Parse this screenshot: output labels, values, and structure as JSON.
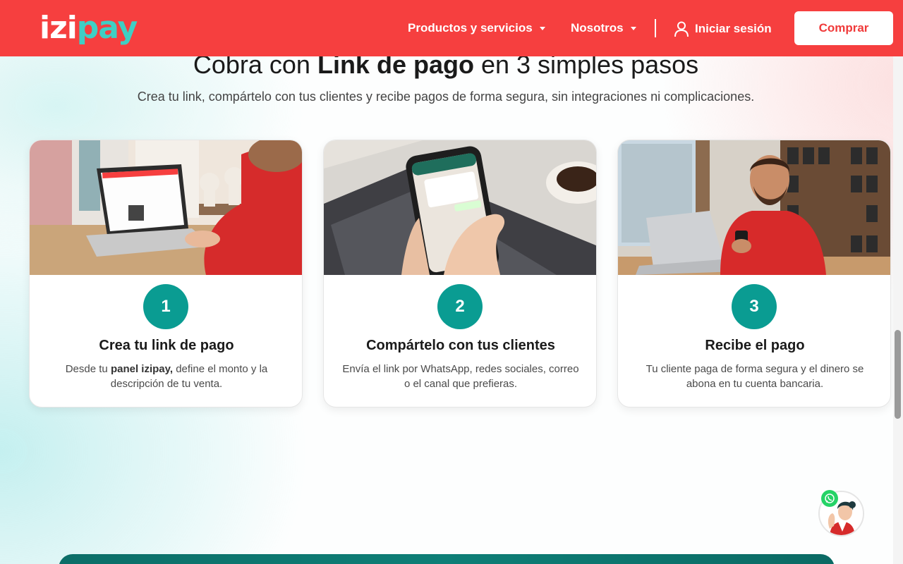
{
  "header": {
    "logo": {
      "part1": "izi",
      "part2": "pay"
    },
    "nav": [
      {
        "label": "Productos y servicios"
      },
      {
        "label": "Nosotros"
      }
    ],
    "login_label": "Iniciar sesión",
    "buy_label": "Comprar",
    "bg_color": "#f63f3f",
    "accent_color": "#3fcfc4"
  },
  "section": {
    "title_pre": "Cobra con ",
    "title_bold": "Link de pago",
    "title_post": " en 3 simples pasos",
    "subtitle": "Crea tu link, compártelo con tus clientes y recibe pagos de forma segura, sin integraciones ni complicaciones."
  },
  "steps": [
    {
      "number": "1",
      "title": "Crea tu link de pago",
      "desc_pre": "Desde tu ",
      "desc_bold": "panel izipay,",
      "desc_post": " define el monto y la descripción de tu venta.",
      "image": "woman-laptop-jewelry-store-photo"
    },
    {
      "number": "2",
      "title": "Compártelo con tus clientes",
      "desc": "Envía el link por WhatsApp, redes sociales, correo o el canal que prefieras.",
      "image": "phone-whatsapp-chat-photo"
    },
    {
      "number": "3",
      "title": "Recibe el pago",
      "desc": "Tu cliente paga de forma segura y el dinero se abona en tu cuenta bancaria.",
      "image": "man-smartphone-shop-photo"
    }
  ],
  "step_color": "#0a9c92",
  "icons": {
    "user": "user-icon",
    "caret": "caret-down-icon",
    "whatsapp": "whatsapp-icon",
    "assistant": "assistant-avatar-icon"
  }
}
